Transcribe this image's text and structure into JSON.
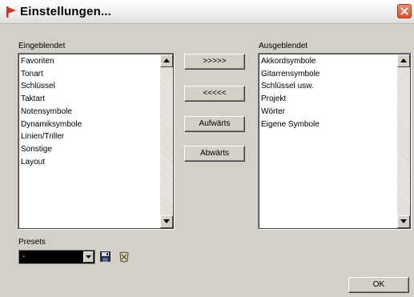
{
  "window": {
    "title": "Einstellungen..."
  },
  "left_panel": {
    "label": "Eingeblendet",
    "items": [
      "Favoriten",
      "Tonart",
      "Schlüssel",
      "Taktart",
      "Notensymbole",
      "Dynamiksymbole",
      "Linien/Triller",
      "Sonstige",
      "Layout"
    ]
  },
  "right_panel": {
    "label": "Ausgeblendet",
    "items": [
      "Akkordsymbole",
      "Gitarrensymbole",
      "Schlüssel usw.",
      "Projekt",
      "Wörter",
      "Eigene Symbole"
    ]
  },
  "buttons": {
    "move_right": ">>>>>",
    "move_left": "<<<<<",
    "up": "Aufwärts",
    "down": "Abwärts",
    "ok": "OK"
  },
  "presets": {
    "label": "Presets",
    "value": "-"
  },
  "colors": {
    "title_accent": "#c0392b",
    "close": "#d8512b",
    "dialog_bg": "#d4d0c8"
  }
}
